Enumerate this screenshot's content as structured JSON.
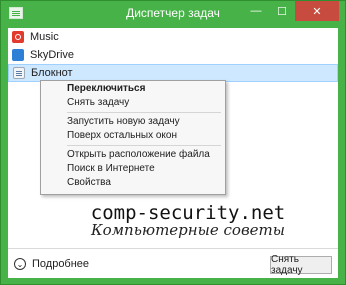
{
  "window": {
    "title": "Диспетчер задач",
    "minimize_glyph": "—",
    "maximize_glyph": "☐",
    "close_glyph": "✕",
    "accent": "#47b247",
    "close_color": "#c74b3e"
  },
  "apps": [
    {
      "name": "Music",
      "icon": "music-icon"
    },
    {
      "name": "SkyDrive",
      "icon": "skydrive-icon"
    },
    {
      "name": "Блокнот",
      "icon": "notepad-icon"
    }
  ],
  "context_menu": {
    "items": [
      "Переключиться",
      "Снять задачу",
      "Запустить новую задачу",
      "Поверх остальных окон",
      "Открыть расположение файла",
      "Поиск в Интернете",
      "Свойства"
    ]
  },
  "watermark": {
    "line1": "comp-security.net",
    "line2": "Компьютерные советы"
  },
  "footer": {
    "more_label": "Подробнее",
    "end_task_label": "Снять задачу"
  }
}
